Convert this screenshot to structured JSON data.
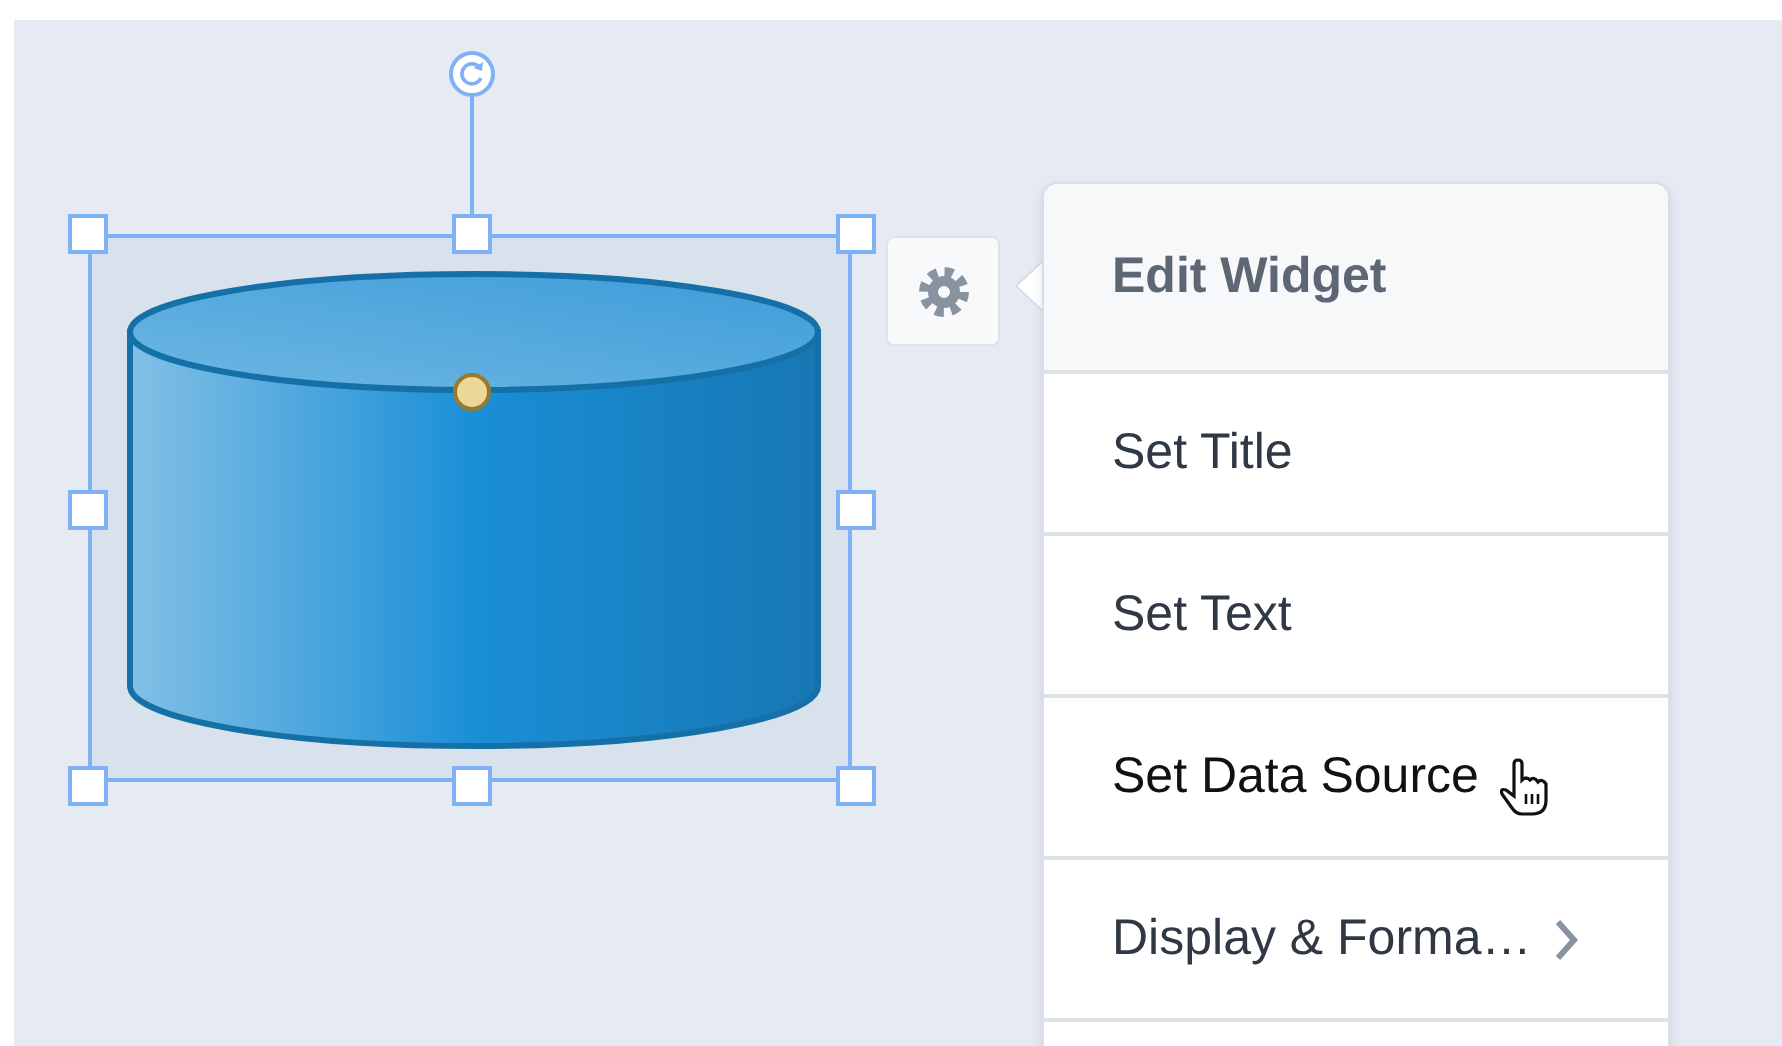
{
  "menu": {
    "title": "Edit Widget",
    "items": [
      {
        "label": "Set Title",
        "kind": "action",
        "hovered": false
      },
      {
        "label": "Set Text",
        "kind": "action",
        "hovered": false
      },
      {
        "label": "Set Data Source",
        "kind": "action",
        "hovered": true
      },
      {
        "label": "Display & Forma…",
        "kind": "submenu",
        "hovered": false
      }
    ]
  }
}
